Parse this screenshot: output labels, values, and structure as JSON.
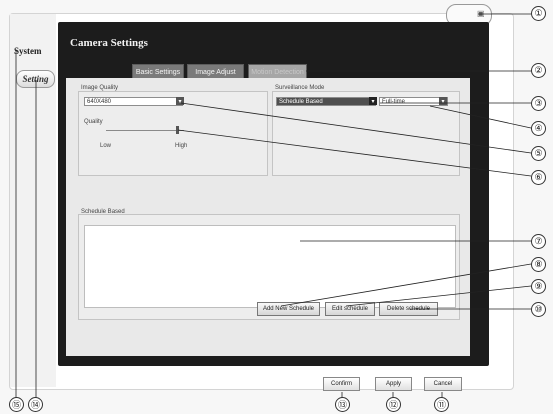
{
  "sidebar": {
    "system_label": "System",
    "setting_label": "Setting"
  },
  "window": {
    "title": "Camera Settings"
  },
  "tabs": [
    {
      "label": "Basic Settings",
      "active": true
    },
    {
      "label": "Image Adjust",
      "active": false
    },
    {
      "label": "Motion Detection",
      "active": false,
      "disabled": true
    }
  ],
  "image_quality": {
    "group_label": "Image Quality",
    "resolution_value": "640X480",
    "quality_label": "Quality",
    "slider_low": "Low",
    "slider_high": "High",
    "slider_level": 1.0
  },
  "surveillance_mode": {
    "group_label": "Surveillance Mode",
    "mode_value": "Schedule Based",
    "time_value": "Full-time"
  },
  "schedule": {
    "group_label": "Schedule Based",
    "add_button": "Add New Schedule",
    "edit_button": "Edit schedule",
    "delete_button": "Delete schedule"
  },
  "footer": {
    "confirm": "Confirm",
    "apply": "Apply",
    "cancel": "Cancel"
  },
  "callouts": [
    "①",
    "②",
    "③",
    "④",
    "⑤",
    "⑥",
    "⑦",
    "⑧",
    "⑨",
    "⑩",
    "⑪",
    "⑫",
    "⑬",
    "⑭",
    "⑮"
  ],
  "colors": {
    "dark_panel": "#1c1c1c",
    "tab_bg": "#7a7a7a",
    "mode_combo": "#555555"
  }
}
